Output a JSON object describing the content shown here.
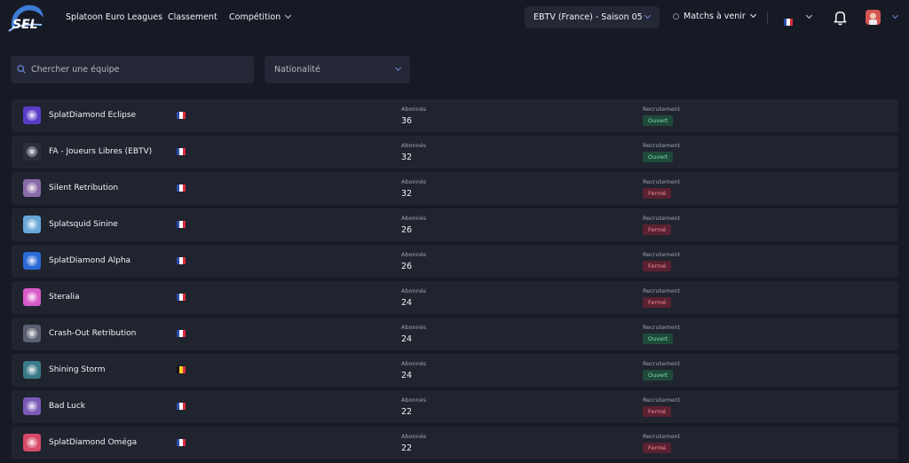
{
  "nav": {
    "brand": "Splatoon Euro Leagues",
    "ranking": "Classement",
    "competition": "Compétition",
    "season": "EBTV (France) - Saison 05",
    "matches": "Matchs à venir",
    "logo_text": "SEL"
  },
  "filters": {
    "search_placeholder": "Chercher une équipe",
    "nationality": "Nationalité"
  },
  "labels": {
    "subscribers": "Abonnés",
    "recruitment": "Recrutement"
  },
  "status": {
    "open": "Ouvert",
    "closed": "Fermé"
  },
  "flags": {
    "fr": [
      "#2d4ba8",
      "#ffffff",
      "#e0283a"
    ],
    "be": [
      "#111111",
      "#f4d02a",
      "#e0283a"
    ]
  },
  "teams": [
    {
      "name": "SplatDiamond Eclipse",
      "flag": "fr",
      "subscribers": "36",
      "recruitment": "open",
      "logo": "#5a3cc8"
    },
    {
      "name": "FA - Joueurs Libres (EBTV)",
      "flag": "fr",
      "subscribers": "32",
      "recruitment": "open",
      "logo": "#2b2f3b"
    },
    {
      "name": "Silent Retribution",
      "flag": "fr",
      "subscribers": "32",
      "recruitment": "closed",
      "logo": "#8a6aa8"
    },
    {
      "name": "Splatsquid Sinine",
      "flag": "fr",
      "subscribers": "26",
      "recruitment": "closed",
      "logo": "#6aa8d8"
    },
    {
      "name": "SplatDiamond Alpha",
      "flag": "fr",
      "subscribers": "26",
      "recruitment": "closed",
      "logo": "#2a6ad8"
    },
    {
      "name": "Steralia",
      "flag": "fr",
      "subscribers": "24",
      "recruitment": "closed",
      "logo": "#d85ac8"
    },
    {
      "name": "Crash-Out Retribution",
      "flag": "fr",
      "subscribers": "24",
      "recruitment": "open",
      "logo": "#5a6070"
    },
    {
      "name": "Shining Storm",
      "flag": "be",
      "subscribers": "24",
      "recruitment": "open",
      "logo": "#3a7a88"
    },
    {
      "name": "Bad Luck",
      "flag": "fr",
      "subscribers": "22",
      "recruitment": "closed",
      "logo": "#7a5ab8"
    },
    {
      "name": "SplatDiamond Oméga",
      "flag": "fr",
      "subscribers": "22",
      "recruitment": "closed",
      "logo": "#d84a6a"
    }
  ]
}
